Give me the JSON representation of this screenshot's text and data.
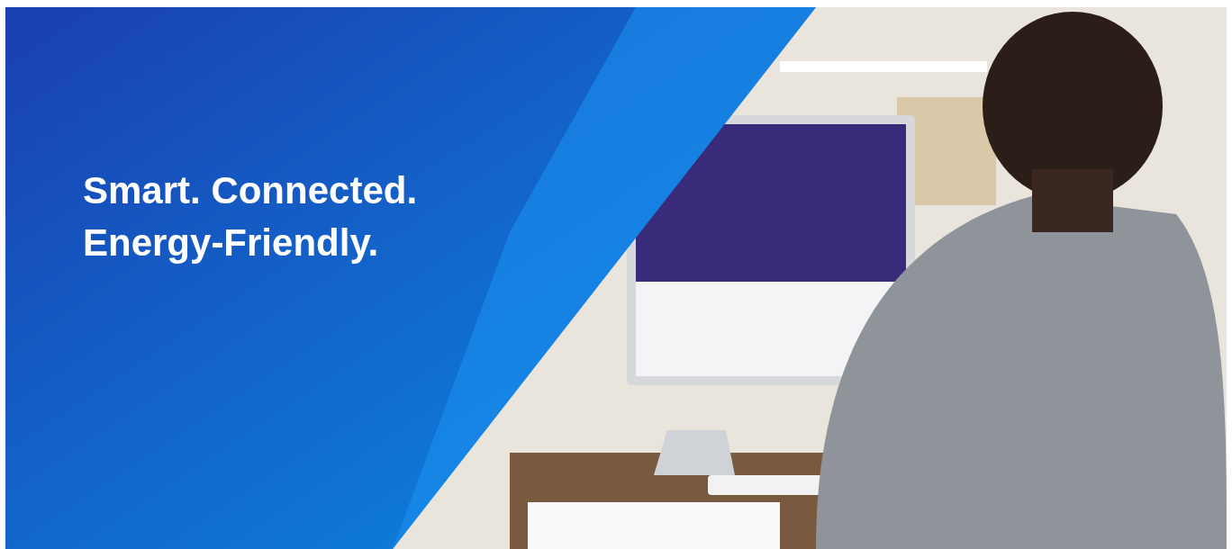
{
  "hero": {
    "headline": [
      "Smart. Connected.",
      "Energy-Friendly."
    ]
  }
}
